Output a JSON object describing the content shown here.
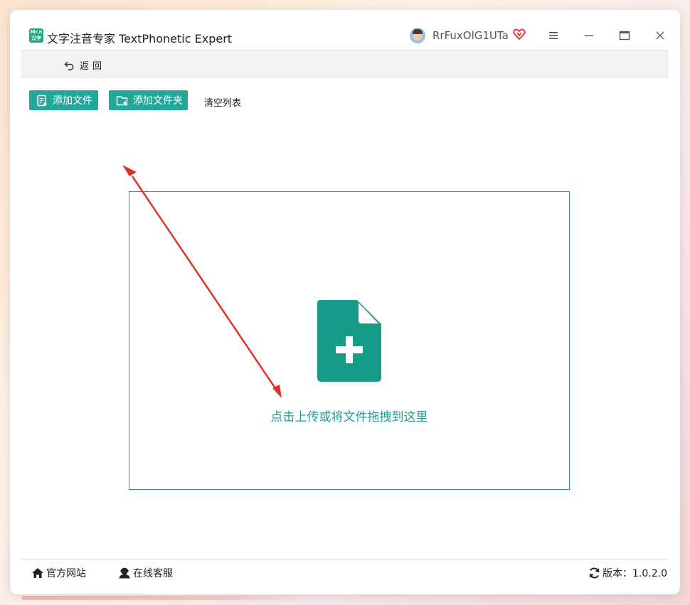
{
  "window": {
    "title": "文字注音专家 TextPhonetic Expert",
    "app_icon_text": "Mr.n 汉字",
    "username": "RrFuxOlG1UTa"
  },
  "toolbar": {
    "back_label": "返回"
  },
  "actions": {
    "add_file": "添加文件",
    "add_folder": "添加文件夹",
    "clear_list": "清空列表"
  },
  "dropzone": {
    "text": "点击上传或将文件拖拽到这里"
  },
  "footer": {
    "website": "官方网站",
    "support": "在线客服",
    "version": "版本：1.0.2.0"
  },
  "colors": {
    "accent": "#20a99a",
    "dropzone_border": "#1c9a8a",
    "arrow": "#e0322a",
    "vip": "#e03a3a"
  },
  "icons": [
    "app-logo-icon",
    "avatar",
    "vip-heart-icon",
    "menu-icon",
    "minimize-icon",
    "maximize-icon",
    "close-icon",
    "back-arrow-icon",
    "add-file-icon",
    "add-folder-icon",
    "file-plus-icon",
    "home-icon",
    "support-icon",
    "refresh-icon"
  ]
}
